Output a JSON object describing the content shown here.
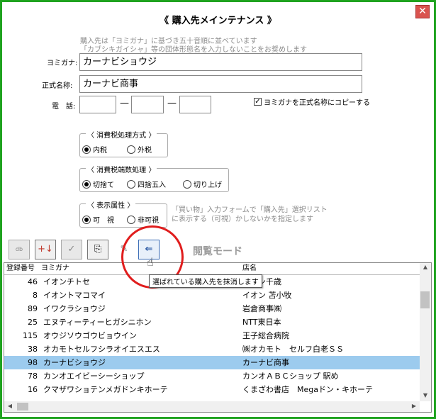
{
  "window": {
    "title": "《 購入先メインテナンス 》",
    "close_label": "✕"
  },
  "note": {
    "line1": "購入先は「ヨミガナ」に基づき五十音順に並べています",
    "line2": "「カブシキガイシャ」等の団体形態名を入力しないことをお奨めします"
  },
  "form": {
    "yomigana_label": "ヨミガナ:",
    "yomigana_value": "カーナビショウジ",
    "name_label": "正式名称:",
    "name_value": "カーナビ商事",
    "phone_label": "電　話:",
    "phone_dash": "—",
    "copy_checkbox_label": "ヨミガナを正式名称にコピーする",
    "copy_checked": "✓"
  },
  "tax_method": {
    "legend": "〈 消費税処理方式 〉",
    "options": [
      "内税",
      "外税"
    ]
  },
  "tax_rounding": {
    "legend": "〈 消費税端数処理 〉",
    "options": [
      "切捨て",
      "四捨五入",
      "切り上げ"
    ]
  },
  "display": {
    "legend": "〈 表示属性 〉",
    "options": [
      "可　視",
      "非可視"
    ],
    "hint_line1": "「買い物」入力フォームで「購入先」選択リスト",
    "hint_line2": "に表示する（可視）かしないかを指定します"
  },
  "toolbar": {
    "db_label": "db",
    "add_label": "+↓",
    "check_label": "✓",
    "search_label": "⎘",
    "edit_label": "✎",
    "delete_label": "⇐",
    "mode_label": "閲覧モード"
  },
  "tooltip": "選ばれている購入先を抹消します",
  "list": {
    "headers": [
      "登録番号",
      "ヨミガナ",
      "店名"
    ],
    "rows": [
      {
        "no": "46",
        "kana": "イオンチトセ",
        "name": "イオン千歳"
      },
      {
        "no": "8",
        "kana": "イオントマコマイ",
        "name": "イオン 苫小牧"
      },
      {
        "no": "89",
        "kana": "イワクラショウジ",
        "name": "岩倉商事㈱"
      },
      {
        "no": "25",
        "kana": "エヌティーティーヒガシニホン",
        "name": "NTT東日本"
      },
      {
        "no": "115",
        "kana": "オウジソウゴウビョウイン",
        "name": "王子総合病院"
      },
      {
        "no": "38",
        "kana": "オカモトセルフシラオイエスエス",
        "name": "㈱オカモト　セルフ白老ＳＳ"
      },
      {
        "no": "98",
        "kana": "カーナビショウジ",
        "name": "カーナビ商事"
      },
      {
        "no": "78",
        "kana": "カンオエイビーシーショップ",
        "name": "カンオＡＢＣショップ 駅め"
      },
      {
        "no": "16",
        "kana": "クマザワショテンメガドンキホーテ",
        "name": "くまざわ書店　Megaドン・キホーテ"
      }
    ]
  }
}
